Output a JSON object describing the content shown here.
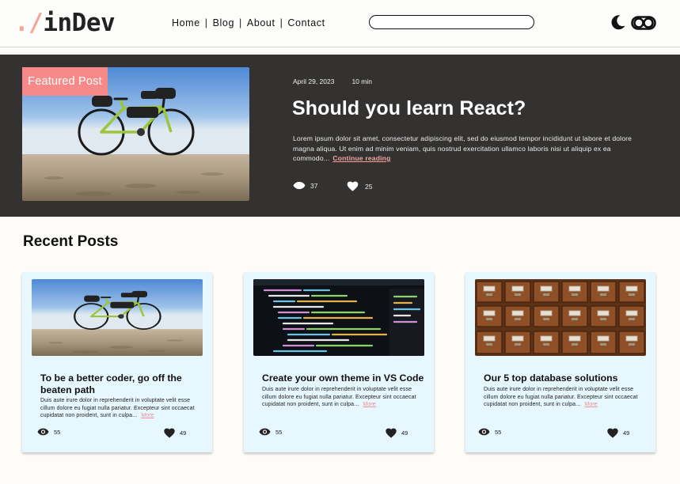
{
  "header": {
    "logo_prefix": "./",
    "logo_name": "inDev",
    "nav": [
      "Home",
      "Blog",
      "About",
      "Contact"
    ],
    "search_placeholder": ""
  },
  "featured": {
    "badge": "Featured Post",
    "date": "April 29, 2023",
    "read_time": "10 min",
    "title": "Should you learn React?",
    "excerpt": "Lorem ipsum dolor sit amet, consectetur adipiscing elit, sed do eiusmod tempor incididunt ut labore et dolore magna aliqua. Ut enim ad minim veniam, quis nostrud exercitation ullamco laboris nisi ut aliquip ex ea commodo...",
    "continue_label": "Continue reading",
    "views": "37",
    "likes": "25"
  },
  "recent": {
    "title": "Recent Posts",
    "posts": [
      {
        "title": "To be a better coder, go off the beaten path",
        "excerpt": "Duis aute irure dolor in reprehenderit in voluptate velit esse cillum dolore eu fugiat nulla pariatur. Excepteur sint occaecat cupidatat non proident, sunt in culpa...",
        "more": "More",
        "views": "55",
        "likes": "49"
      },
      {
        "title": "Create your own theme in VS Code",
        "excerpt": "Duis aute irure dolor in reprehenderit in voluptate velit esse cillum dolore eu fugiat nulla pariatur. Excepteur sint occaecat cupidatat non proident, sunt in culpa...",
        "more": "More",
        "views": "55",
        "likes": "49"
      },
      {
        "title": "Our 5 top database solutions",
        "excerpt": "Duis aute irure dolor in reprehenderit in voluptate velit esse cillum dolore eu fugiat nulla pariatur. Excepteur sint occaecat cupidatat non proident, sunt in culpa...",
        "more": "More",
        "views": "55",
        "likes": "49"
      }
    ]
  },
  "icons": {
    "theme": "moon-icon",
    "toggle": "toggle-icon",
    "views": "eye-icon",
    "likes": "heart-icon"
  },
  "colors": {
    "accent": "#f68a88",
    "hero_bg": "#333231",
    "card_bg": "#e6f7ff",
    "logo_accent": "#f4a593"
  }
}
